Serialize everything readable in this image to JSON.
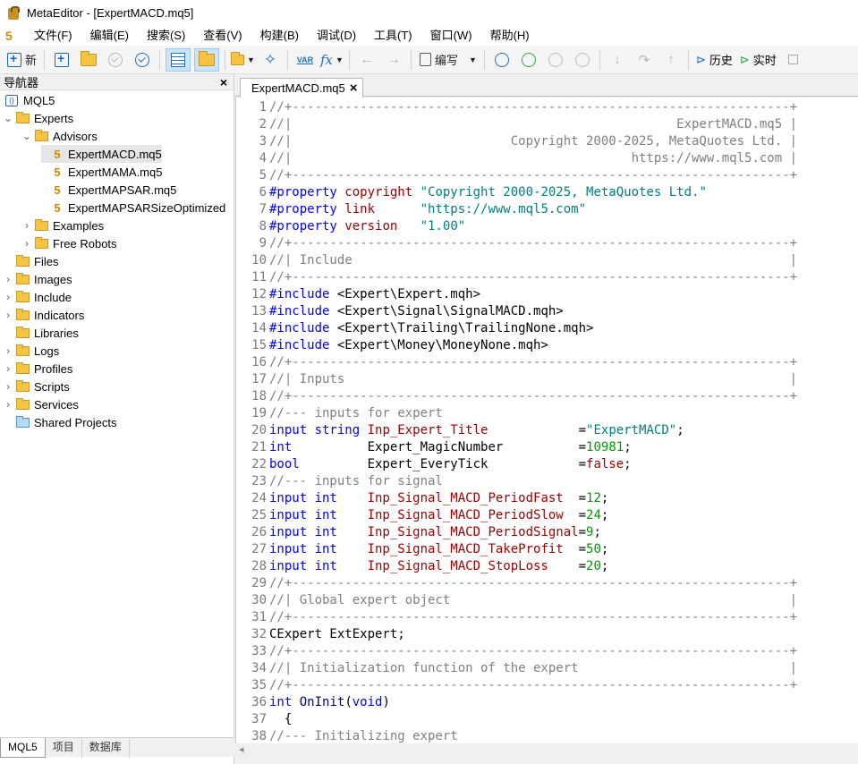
{
  "window": {
    "title": "MetaEditor - [ExpertMACD.mq5]"
  },
  "menu": {
    "logo": "5",
    "items": [
      "文件(F)",
      "编辑(E)",
      "搜索(S)",
      "查看(V)",
      "构建(B)",
      "调试(D)",
      "工具(T)",
      "窗口(W)",
      "帮助(H)"
    ]
  },
  "toolbar": {
    "new_label": "新",
    "compile_label": "编写",
    "history_label": "历史",
    "realtime_label": "实时",
    "var_label": "VAR",
    "fx_label": "fx"
  },
  "navigator": {
    "title": "导航器",
    "close": "×",
    "nodes": [
      {
        "label": "MQL5",
        "kind": "root",
        "depth": 0
      },
      {
        "label": "Experts",
        "kind": "folder",
        "depth": 1,
        "expanded": true
      },
      {
        "label": "Advisors",
        "kind": "folder",
        "depth": 2,
        "expanded": true
      },
      {
        "label": "ExpertMACD.mq5",
        "kind": "file",
        "depth": 3,
        "selected": true
      },
      {
        "label": "ExpertMAMA.mq5",
        "kind": "file",
        "depth": 3
      },
      {
        "label": "ExpertMAPSAR.mq5",
        "kind": "file",
        "depth": 3
      },
      {
        "label": "ExpertMAPSARSizeOptimized",
        "kind": "file",
        "depth": 3
      },
      {
        "label": "Examples",
        "kind": "folder",
        "depth": 2,
        "expanded": false
      },
      {
        "label": "Free Robots",
        "kind": "folder",
        "depth": 2,
        "expanded": false
      },
      {
        "label": "Files",
        "kind": "folder",
        "depth": 1,
        "leaf": true
      },
      {
        "label": "Images",
        "kind": "folder",
        "depth": 1,
        "expanded": false
      },
      {
        "label": "Include",
        "kind": "folder",
        "depth": 1,
        "expanded": false
      },
      {
        "label": "Indicators",
        "kind": "folder",
        "depth": 1,
        "expanded": false
      },
      {
        "label": "Libraries",
        "kind": "folder",
        "depth": 1,
        "leaf": true
      },
      {
        "label": "Logs",
        "kind": "folder",
        "depth": 1,
        "expanded": false
      },
      {
        "label": "Profiles",
        "kind": "folder",
        "depth": 1,
        "expanded": false
      },
      {
        "label": "Scripts",
        "kind": "folder",
        "depth": 1,
        "expanded": false
      },
      {
        "label": "Services",
        "kind": "folder",
        "depth": 1,
        "expanded": false
      },
      {
        "label": "Shared Projects",
        "kind": "shared",
        "depth": 1,
        "leaf": true
      }
    ],
    "tabs": [
      "MQL5",
      "项目",
      "数据库"
    ]
  },
  "editor": {
    "tab_label": "ExpertMACD.mq5",
    "tab_close": "×",
    "lines": [
      [
        [
          "cmt",
          "//+------------------------------------------------------------------+"
        ]
      ],
      [
        [
          "cmt",
          "//|                                                   ExpertMACD.mq5 |"
        ]
      ],
      [
        [
          "cmt",
          "//|                             Copyright 2000-2025, MetaQuotes Ltd. |"
        ]
      ],
      [
        [
          "cmt",
          "//|                                             https://www.mql5.com |"
        ]
      ],
      [
        [
          "cmt",
          "//+------------------------------------------------------------------+"
        ]
      ],
      [
        [
          "pp",
          "#property"
        ],
        [
          "plain",
          " "
        ],
        [
          "var",
          "copyright"
        ],
        [
          "plain",
          " "
        ],
        [
          "str",
          "\"Copyright 2000-2025, MetaQuotes Ltd.\""
        ]
      ],
      [
        [
          "pp",
          "#property"
        ],
        [
          "plain",
          " "
        ],
        [
          "var",
          "link"
        ],
        [
          "plain",
          "      "
        ],
        [
          "str",
          "\"https://www.mql5.com\""
        ]
      ],
      [
        [
          "pp",
          "#property"
        ],
        [
          "plain",
          " "
        ],
        [
          "var",
          "version"
        ],
        [
          "plain",
          "   "
        ],
        [
          "str",
          "\"1.00\""
        ]
      ],
      [
        [
          "cmt",
          "//+------------------------------------------------------------------+"
        ]
      ],
      [
        [
          "cmt",
          "//| Include                                                          |"
        ]
      ],
      [
        [
          "cmt",
          "//+------------------------------------------------------------------+"
        ]
      ],
      [
        [
          "pp",
          "#include"
        ],
        [
          "plain",
          " <Expert\\Expert.mqh>"
        ]
      ],
      [
        [
          "pp",
          "#include"
        ],
        [
          "plain",
          " <Expert\\Signal\\SignalMACD.mqh>"
        ]
      ],
      [
        [
          "pp",
          "#include"
        ],
        [
          "plain",
          " <Expert\\Trailing\\TrailingNone.mqh>"
        ]
      ],
      [
        [
          "pp",
          "#include"
        ],
        [
          "plain",
          " <Expert\\Money\\MoneyNone.mqh>"
        ]
      ],
      [
        [
          "cmt",
          "//+------------------------------------------------------------------+"
        ]
      ],
      [
        [
          "cmt",
          "//| Inputs                                                           |"
        ]
      ],
      [
        [
          "cmt",
          "//+------------------------------------------------------------------+"
        ]
      ],
      [
        [
          "cmt",
          "//--- inputs for expert"
        ]
      ],
      [
        [
          "kw",
          "input string"
        ],
        [
          "plain",
          " "
        ],
        [
          "var",
          "Inp_Expert_Title"
        ],
        [
          "plain",
          "            ="
        ],
        [
          "str",
          "\"ExpertMACD\""
        ],
        [
          "plain",
          ";"
        ]
      ],
      [
        [
          "kw",
          "int"
        ],
        [
          "plain",
          "          Expert_MagicNumber          ="
        ],
        [
          "num",
          "10981"
        ],
        [
          "plain",
          ";"
        ]
      ],
      [
        [
          "kw",
          "bool"
        ],
        [
          "plain",
          "         Expert_EveryTick            ="
        ],
        [
          "var",
          "false"
        ],
        [
          "plain",
          ";"
        ]
      ],
      [
        [
          "cmt",
          "//--- inputs for signal"
        ]
      ],
      [
        [
          "kw",
          "input int"
        ],
        [
          "plain",
          "    "
        ],
        [
          "var",
          "Inp_Signal_MACD_PeriodFast"
        ],
        [
          "plain",
          "  ="
        ],
        [
          "num",
          "12"
        ],
        [
          "plain",
          ";"
        ]
      ],
      [
        [
          "kw",
          "input int"
        ],
        [
          "plain",
          "    "
        ],
        [
          "var",
          "Inp_Signal_MACD_PeriodSlow"
        ],
        [
          "plain",
          "  ="
        ],
        [
          "num",
          "24"
        ],
        [
          "plain",
          ";"
        ]
      ],
      [
        [
          "kw",
          "input int"
        ],
        [
          "plain",
          "    "
        ],
        [
          "var",
          "Inp_Signal_MACD_PeriodSignal"
        ],
        [
          "plain",
          "="
        ],
        [
          "num",
          "9"
        ],
        [
          "plain",
          ";"
        ]
      ],
      [
        [
          "kw",
          "input int"
        ],
        [
          "plain",
          "    "
        ],
        [
          "var",
          "Inp_Signal_MACD_TakeProfit"
        ],
        [
          "plain",
          "  ="
        ],
        [
          "num",
          "50"
        ],
        [
          "plain",
          ";"
        ]
      ],
      [
        [
          "kw",
          "input int"
        ],
        [
          "plain",
          "    "
        ],
        [
          "var",
          "Inp_Signal_MACD_StopLoss"
        ],
        [
          "plain",
          "    ="
        ],
        [
          "num",
          "20"
        ],
        [
          "plain",
          ";"
        ]
      ],
      [
        [
          "cmt",
          "//+------------------------------------------------------------------+"
        ]
      ],
      [
        [
          "cmt",
          "//| Global expert object                                             |"
        ]
      ],
      [
        [
          "cmt",
          "//+------------------------------------------------------------------+"
        ]
      ],
      [
        [
          "plain",
          "CExpert ExtExpert;"
        ]
      ],
      [
        [
          "cmt",
          "//+------------------------------------------------------------------+"
        ]
      ],
      [
        [
          "cmt",
          "//| Initialization function of the expert                            |"
        ]
      ],
      [
        [
          "cmt",
          "//+------------------------------------------------------------------+"
        ]
      ],
      [
        [
          "kw",
          "int"
        ],
        [
          "plain",
          " "
        ],
        [
          "fn",
          "OnInit"
        ],
        [
          "plain",
          "("
        ],
        [
          "kw",
          "void"
        ],
        [
          "plain",
          ")"
        ]
      ],
      [
        [
          "plain",
          "  {"
        ]
      ],
      [
        [
          "cmt",
          "//--- Initializing expert"
        ]
      ]
    ]
  },
  "colors": {
    "accent": "#1e6fc4",
    "comment": "#808080",
    "keyword": "#0000ff",
    "string": "#008080",
    "number": "#009900",
    "identifier": "#990000"
  }
}
